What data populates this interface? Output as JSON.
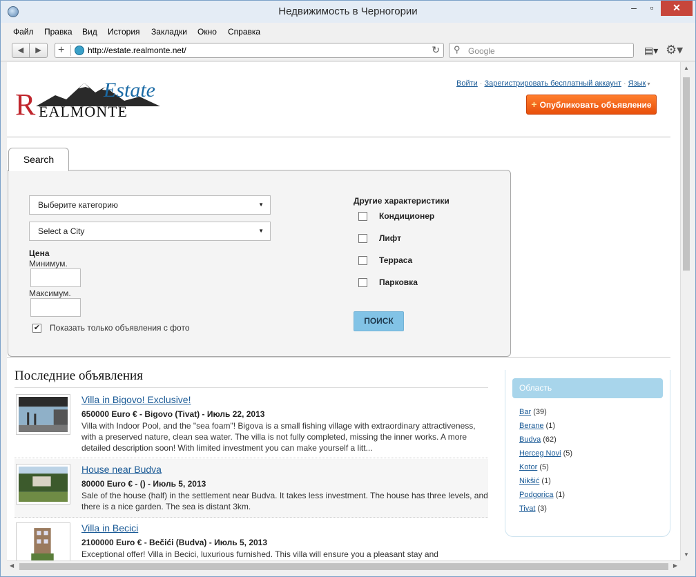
{
  "window": {
    "title": "Недвижимость в Черногории",
    "min": "–",
    "max": "▫",
    "close": "✕"
  },
  "menu": [
    "Файл",
    "Правка",
    "Вид",
    "История",
    "Закладки",
    "Окно",
    "Справка"
  ],
  "toolbar": {
    "url": "http://estate.realmonte.net/",
    "search_placeholder": "Google"
  },
  "header": {
    "logo_r": "R",
    "logo_rest": "EALMONTE",
    "logo_estate": "Estate",
    "login": "Войти",
    "register": "Зарегистрировать бесплатный аккаунт",
    "language": "Язык",
    "publish": "Опубликовать объявление"
  },
  "search": {
    "tab": "Search",
    "category": "Выберите категорию",
    "city": "Select a City",
    "price_label": "Цена",
    "min_label": "Минимум.",
    "max_label": "Максимум.",
    "photo_only": "Показать только объявления с фото",
    "photo_only_checked": true,
    "other_label": "Другие характеристики",
    "features": [
      "Кондиционер",
      "Лифт",
      "Терраса",
      "Парковка"
    ],
    "submit": "ПОИСК"
  },
  "listings_title": "Последние объявления",
  "listings": [
    {
      "title": "Villa in Bigovo! Exclusive!",
      "meta": "650000 Euro € - Bigovo (Tivat) - Июль 22, 2013",
      "desc": "Villa with Indoor Pool, and the \"sea foam\"! Bigova is a small fishing village with extraordinary attractiveness, with a preserved nature, clean sea water. The villa is not fully completed, missing the inner works. A more detailed description soon! With limited investment you can make yourself a litt..."
    },
    {
      "title": "House near Budva",
      "meta": "80000 Euro € - () - Июль 5, 2013",
      "desc": "Sale of the house (half) in the settlement near Budva. It takes less investment. The house has three levels, and there is a nice garden. The sea is distant 3km."
    },
    {
      "title": "Villa in Becici",
      "meta": "2100000 Euro € - Bečići (Budva) - Июль 5, 2013",
      "desc": "Exceptional offer! Villa in Becici, luxurious furnished. This villa will ensure you a pleasant stay and"
    }
  ],
  "sidebar": {
    "title": "Область",
    "areas": [
      {
        "name": "Bar",
        "count": "(39)"
      },
      {
        "name": "Berane",
        "count": "(1)"
      },
      {
        "name": "Budva",
        "count": "(62)"
      },
      {
        "name": "Herceg Novi",
        "count": "(5)"
      },
      {
        "name": "Kotor",
        "count": "(5)"
      },
      {
        "name": "Nikšić",
        "count": "(1)"
      },
      {
        "name": "Podgorica",
        "count": "(1)"
      },
      {
        "name": "Tivat",
        "count": "(3)"
      }
    ]
  }
}
